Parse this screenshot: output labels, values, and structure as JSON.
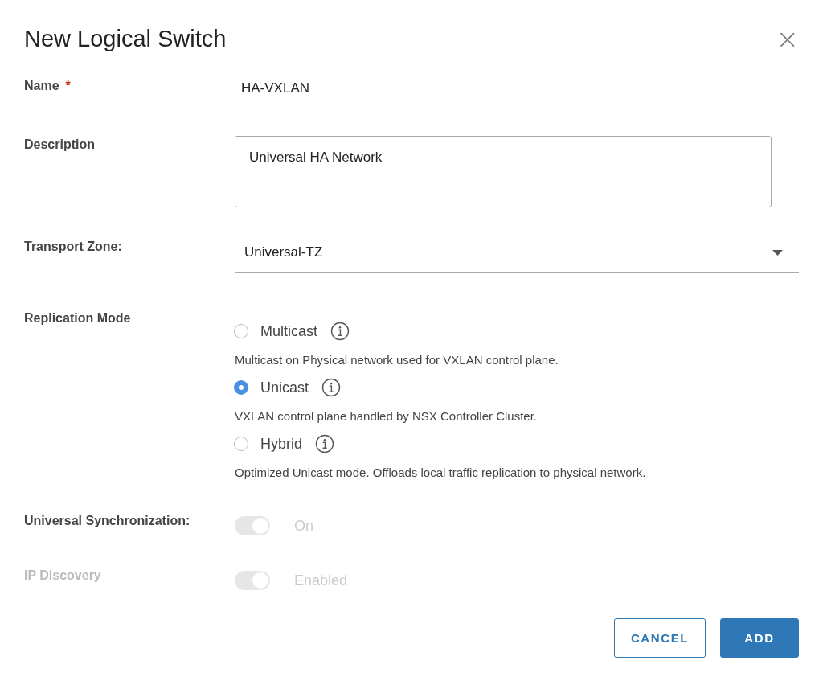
{
  "dialog": {
    "title": "New Logical Switch",
    "close": "×"
  },
  "name": {
    "label": "Name",
    "required_mark": "*",
    "value": "HA-VXLAN"
  },
  "description": {
    "label": "Description",
    "value": "Universal HA Network"
  },
  "transport_zone": {
    "label": "Transport Zone:",
    "value": "Universal-TZ"
  },
  "replication_mode": {
    "label": "Replication Mode",
    "options": [
      {
        "label": "Multicast",
        "help": "Multicast on Physical network used for VXLAN control plane.",
        "selected": false
      },
      {
        "label": "Unicast",
        "help": "VXLAN control plane handled by NSX Controller Cluster.",
        "selected": true
      },
      {
        "label": "Hybrid",
        "help": "Optimized Unicast mode. Offloads local traffic replication to physical network.",
        "selected": false
      }
    ]
  },
  "toggles": [
    {
      "label": "Universal Synchronization:",
      "state_text": "On",
      "on": true,
      "disabled": true,
      "dimmed": false
    },
    {
      "label": "IP Discovery",
      "state_text": "Enabled",
      "on": true,
      "disabled": true,
      "dimmed": true
    }
  ],
  "buttons": [
    {
      "label": "CANCEL",
      "kind": "secondary"
    },
    {
      "label": "ADD",
      "kind": "primary"
    }
  ]
}
